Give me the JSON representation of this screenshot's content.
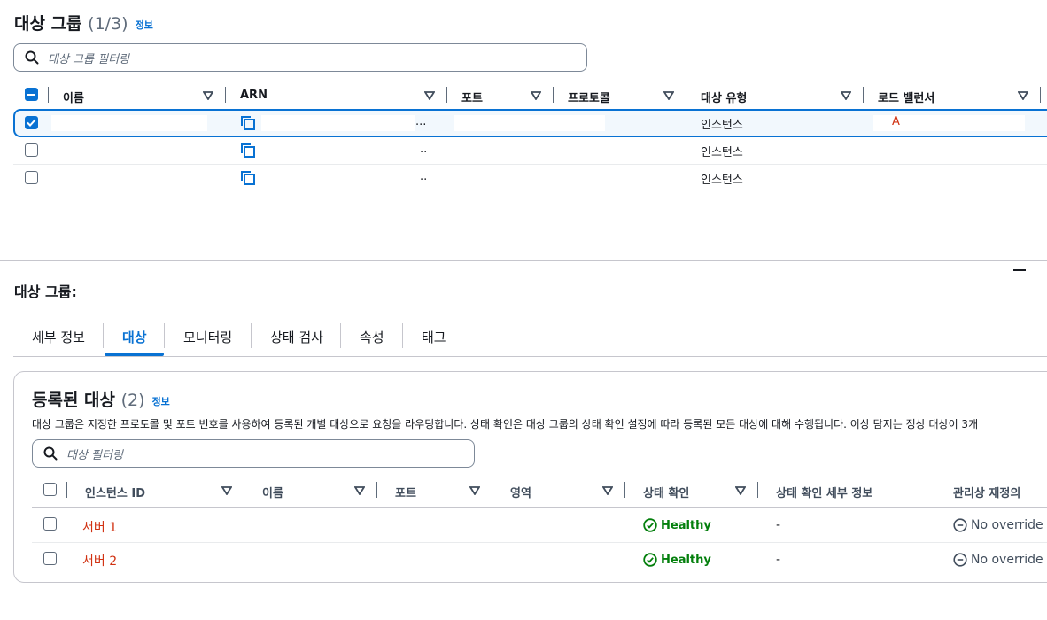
{
  "target_groups": {
    "title": "대상 그룹",
    "count": "(1/3)",
    "info_label": "정보",
    "filter_placeholder": "대상 그룹 필터링",
    "columns": [
      "이름",
      "ARN",
      "포트",
      "프로토콜",
      "대상 유형",
      "로드 밸런서"
    ],
    "rows": [
      {
        "selected": true,
        "arn_suffix": "...",
        "type": "인스턴스",
        "lb": "A"
      },
      {
        "selected": false,
        "arn_suffix": "..",
        "type": "인스턴스",
        "lb": ""
      },
      {
        "selected": false,
        "arn_suffix": "..",
        "type": "인스턴스",
        "lb": ""
      }
    ]
  },
  "detail": {
    "title": "대상 그룹: ",
    "tabs": [
      "세부 정보",
      "대상",
      "모니터링",
      "상태 검사",
      "속성",
      "태그"
    ],
    "active_tab": "대상"
  },
  "registered": {
    "title": "등록된 대상",
    "count": "(2)",
    "info_label": "정보",
    "description": "대상 그룹은 지정한 프로토콜 및 포트 번호를 사용하여 등록된 개별 대상으로 요청을 라우팅합니다. 상태 확인은 대상 그룹의 상태 확인 설정에 따라 등록된 모든 대상에 대해 수행됩니다. 이상 탐지는 정상 대상이 3개",
    "filter_placeholder": "대상 필터링",
    "columns": [
      "인스턴스 ID",
      "이름",
      "포트",
      "영역",
      "상태 확인",
      "상태 확인 세부 정보",
      "관리상 재정의"
    ],
    "rows": [
      {
        "id": "서버 1",
        "health": "Healthy",
        "detail": "-",
        "override": "No override"
      },
      {
        "id": "서버 2",
        "health": "Healthy",
        "detail": "-",
        "override": "No override"
      }
    ]
  },
  "colors": {
    "accent": "#0972d3",
    "healthy": "#037f0c",
    "error_red": "#d13212"
  }
}
